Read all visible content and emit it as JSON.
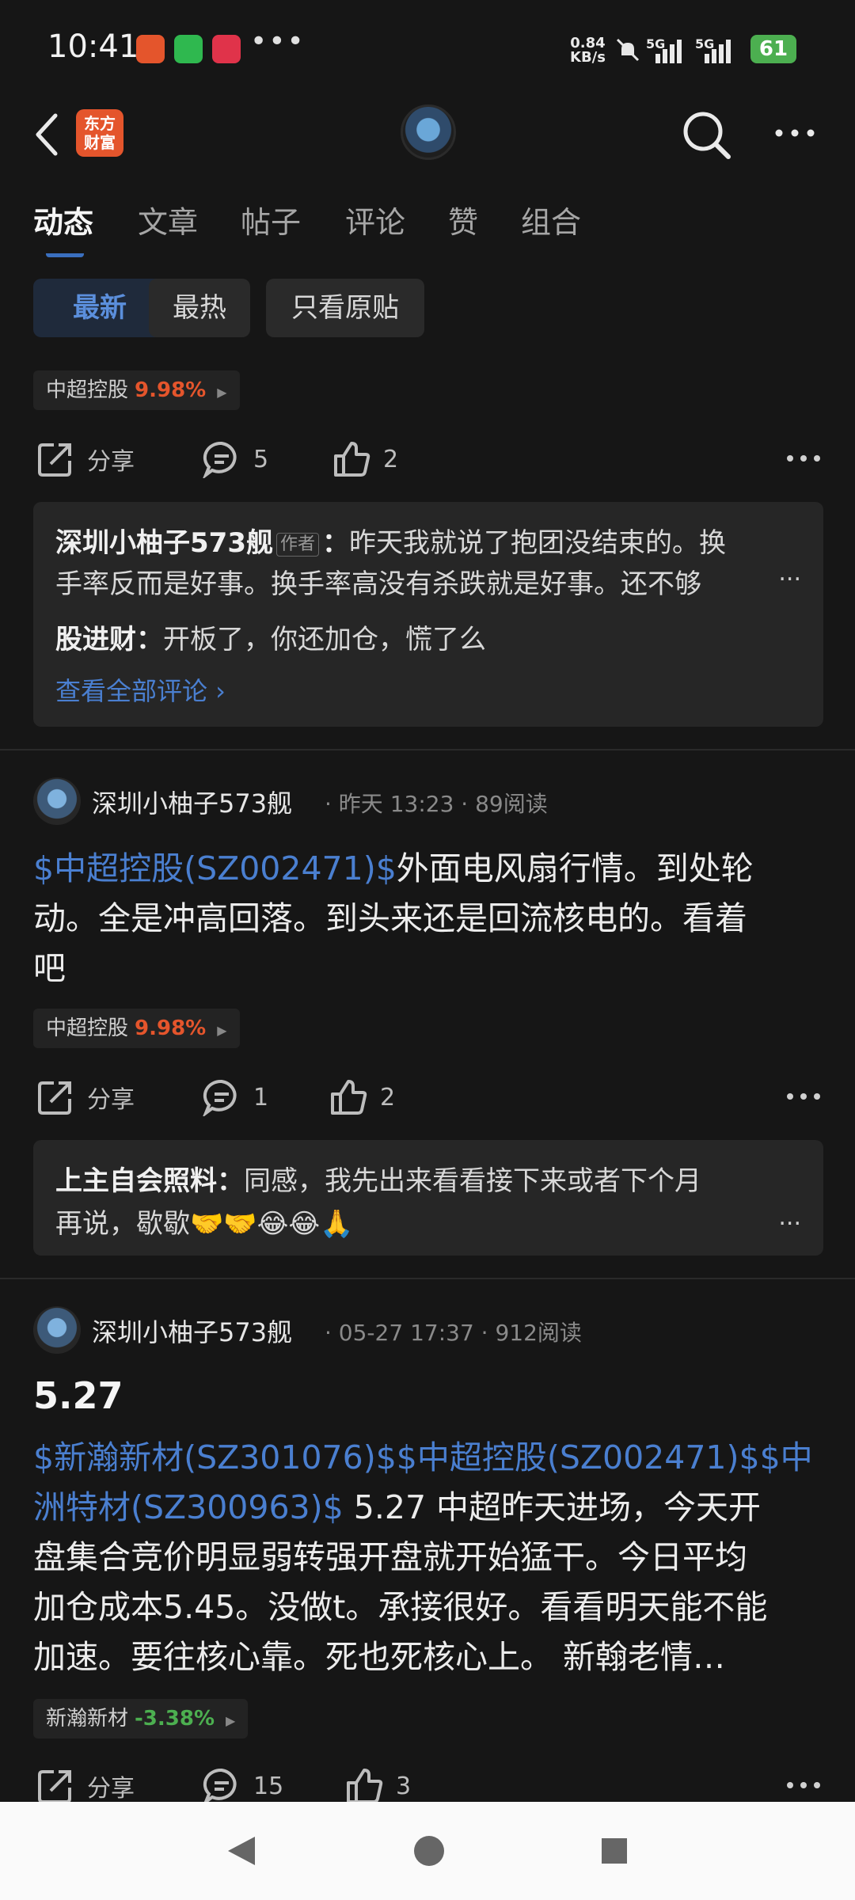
{
  "status_bar": {
    "time": "10:41",
    "overflow": "•••",
    "net_speed_value": "0.84",
    "net_speed_unit": "KB/s",
    "signal1": "5G",
    "signal2": "5G",
    "battery": "61"
  },
  "header": {
    "logo_line1": "东方",
    "logo_line2": "财富"
  },
  "tabs": [
    "动态",
    "文章",
    "帖子",
    "评论",
    "赞",
    "组合"
  ],
  "filters": [
    "最新",
    "最热",
    "只看原贴"
  ],
  "colors": {
    "up": "#e4552c",
    "down": "#4caf50",
    "link": "#4a7fd0"
  },
  "post0": {
    "stock": {
      "name": "中超控股",
      "change": "9.98%"
    },
    "share": "分享",
    "comments": "5",
    "likes": "2",
    "replies": [
      {
        "name": "深圳小柚子573舰",
        "tag": "作者",
        "sep": "：",
        "text1": "昨天我就说了抱团没结束的。换",
        "text2": "手率反而是好事。换手率高没有杀跌就是好事。还不够"
      },
      {
        "name": "股进财",
        "sep": "：",
        "text1": "开板了，你还加仓，慌了么"
      }
    ],
    "see_all": "查看全部评论 ›",
    "more": "..."
  },
  "post1": {
    "user": "深圳小柚子573舰",
    "meta": "· 昨天 13:23 · 89阅读",
    "link": "$中超控股(SZ002471)$",
    "text_line1": "外面电风扇行情。到处轮",
    "text_line2": "动。全是冲高回落。到头来还是回流核电的。看着",
    "text_line3": "吧",
    "stock": {
      "name": "中超控股",
      "change": "9.98%"
    },
    "share": "分享",
    "comments": "1",
    "likes": "2",
    "reply": {
      "name": "上主自会照料",
      "sep": "：",
      "text1": "同感，我先出来看看接下来或者下个月",
      "text2": "再说，歇歇🤝🤝😂😂🙏"
    },
    "more": "..."
  },
  "post2": {
    "user": "深圳小柚子573舰",
    "meta": "· 05-27 17:37 · 912阅读",
    "title": "5.27",
    "link1": "$新瀚新材(SZ301076)$",
    "link2": "$中超控股(SZ002471)$",
    "link3a": "$中",
    "link3b": "洲特材(SZ300963)$",
    "text_line2": " 5.27  中超昨天进场，今天开",
    "text_line3": "盘集合竞价明显弱转强开盘就开始猛干。今日平均",
    "text_line4": "加仓成本5.45。没做t。承接很好。看看明天能不能",
    "text_line5": "加速。要往核心靠。死也死核心上。  新翰老情…",
    "stock": {
      "name": "新瀚新材",
      "change": "-3.38%"
    },
    "share": "分享",
    "comments": "15",
    "likes": "3"
  }
}
